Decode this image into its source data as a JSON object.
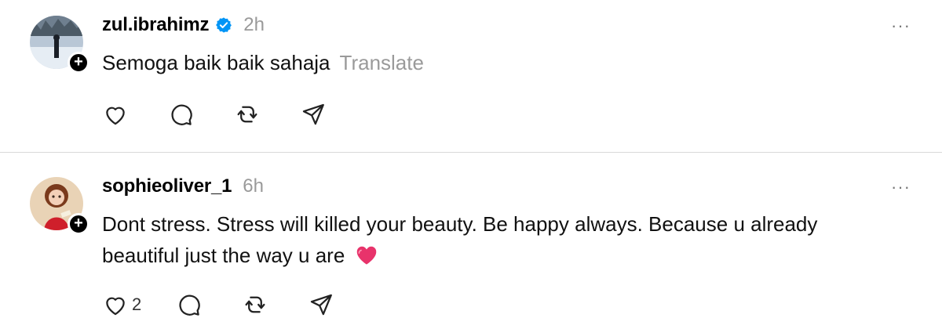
{
  "posts": [
    {
      "username": "zul.ibrahimz",
      "verified": true,
      "time": "2h",
      "text": "Semoga baik baik sahaja",
      "translate_label": "Translate",
      "more_label": "···",
      "like_count": ""
    },
    {
      "username": "sophieoliver_1",
      "verified": false,
      "time": "6h",
      "text_line1": "Dont stress. Stress will killed your beauty. Be happy always. Because u already",
      "text_line2": "beautiful just the way u are",
      "more_label": "···",
      "like_count": "2"
    }
  ],
  "icons": {
    "verified": "verified-badge-icon",
    "like": "heart-icon",
    "comment": "comment-icon",
    "repost": "repost-icon",
    "share": "send-icon",
    "emoji": "pink-heart-emoji"
  },
  "colors": {
    "verified": "#0095f6",
    "muted": "#9a9a9a",
    "heart_emoji": "#e8336b"
  }
}
